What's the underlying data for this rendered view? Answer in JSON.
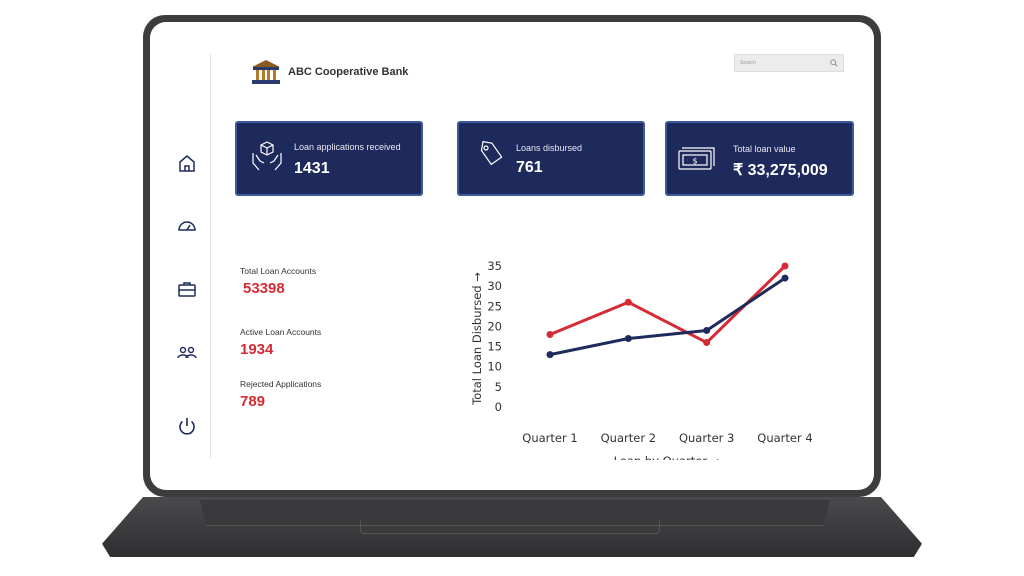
{
  "brand": {
    "name": "ABC Cooperative Bank"
  },
  "search": {
    "placeholder": "Search"
  },
  "sidebar": {
    "items": [
      {
        "icon": "home-icon"
      },
      {
        "icon": "dashboard-gauge-icon"
      },
      {
        "icon": "briefcase-icon"
      },
      {
        "icon": "users-icon"
      },
      {
        "icon": "power-icon"
      }
    ]
  },
  "kpis": [
    {
      "label": "Loan applications received",
      "value": "1431",
      "icon": "hands-box-icon"
    },
    {
      "label": "Loans disbursed",
      "value": "761",
      "icon": "tag-icon"
    },
    {
      "label": "Total loan value",
      "value": "₹ 33,275,009",
      "icon": "cash-icon"
    }
  ],
  "stats": [
    {
      "label": "Total Loan Accounts",
      "value": "53398"
    },
    {
      "label": "Active Loan Accounts",
      "value": "1934"
    },
    {
      "label": "Rejected Applications",
      "value": "789"
    }
  ],
  "colors": {
    "card_bg": "#1f2a5c",
    "accent_red": "#d62a35",
    "series_navy": "#1f2a5c"
  },
  "chart_data": {
    "type": "line",
    "xlabel": "Loan by Quarter →",
    "ylabel": "Total Loan Disbursed →",
    "categories": [
      "Quarter 1",
      "Quarter 2",
      "Quarter 3",
      "Quarter 4"
    ],
    "ylim": [
      0,
      35
    ],
    "yticks": [
      "0",
      "5",
      "10",
      "15",
      "20",
      "25",
      "30",
      "35"
    ],
    "series": [
      {
        "values": [
          18,
          26,
          16,
          35
        ],
        "color": "#d62a35"
      },
      {
        "values": [
          13,
          17,
          19,
          32
        ],
        "color": "#1f2a5c"
      }
    ],
    "grid": false,
    "legend": "none"
  }
}
